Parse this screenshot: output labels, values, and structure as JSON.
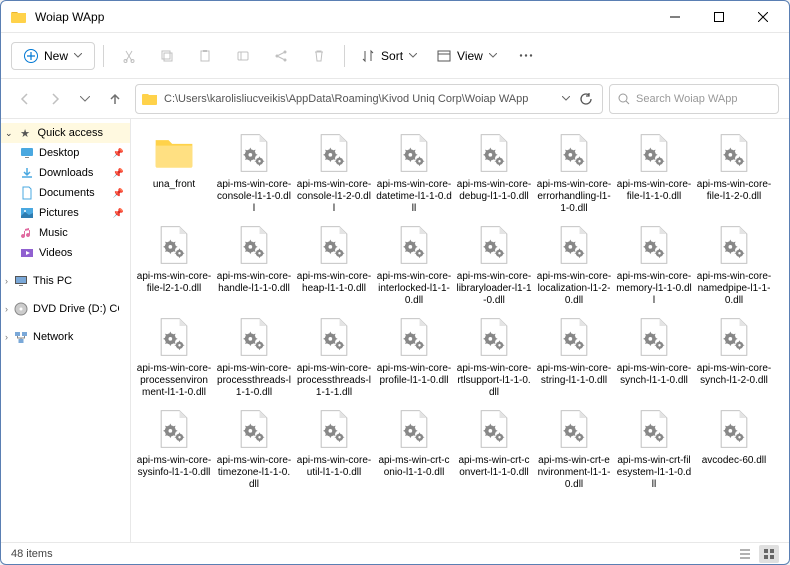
{
  "window": {
    "title": "Woiap WApp"
  },
  "toolbar": {
    "new_label": "New",
    "sort_label": "Sort",
    "view_label": "View"
  },
  "addressbar": {
    "path": "C:\\Users\\karolisliucveikis\\AppData\\Roaming\\Kivod Uniq Corp\\Woiap WApp",
    "search_placeholder": "Search Woiap WApp"
  },
  "sidebar": {
    "quick_access": "Quick access",
    "desktop": "Desktop",
    "downloads": "Downloads",
    "documents": "Documents",
    "pictures": "Pictures",
    "music": "Music",
    "videos": "Videos",
    "this_pc": "This PC",
    "dvd": "DVD Drive (D:) CCCC",
    "network": "Network"
  },
  "files": [
    {
      "name": "una_front",
      "type": "folder"
    },
    {
      "name": "api-ms-win-core-console-l1-1-0.dll",
      "type": "dll"
    },
    {
      "name": "api-ms-win-core-console-l1-2-0.dll",
      "type": "dll"
    },
    {
      "name": "api-ms-win-core-datetime-l1-1-0.dll",
      "type": "dll"
    },
    {
      "name": "api-ms-win-core-debug-l1-1-0.dll",
      "type": "dll"
    },
    {
      "name": "api-ms-win-core-errorhandling-l1-1-0.dll",
      "type": "dll"
    },
    {
      "name": "api-ms-win-core-file-l1-1-0.dll",
      "type": "dll"
    },
    {
      "name": "api-ms-win-core-file-l1-2-0.dll",
      "type": "dll"
    },
    {
      "name": "api-ms-win-core-file-l2-1-0.dll",
      "type": "dll"
    },
    {
      "name": "api-ms-win-core-handle-l1-1-0.dll",
      "type": "dll"
    },
    {
      "name": "api-ms-win-core-heap-l1-1-0.dll",
      "type": "dll"
    },
    {
      "name": "api-ms-win-core-interlocked-l1-1-0.dll",
      "type": "dll"
    },
    {
      "name": "api-ms-win-core-libraryloader-l1-1-0.dll",
      "type": "dll"
    },
    {
      "name": "api-ms-win-core-localization-l1-2-0.dll",
      "type": "dll"
    },
    {
      "name": "api-ms-win-core-memory-l1-1-0.dll",
      "type": "dll"
    },
    {
      "name": "api-ms-win-core-namedpipe-l1-1-0.dll",
      "type": "dll"
    },
    {
      "name": "api-ms-win-core-processenvironment-l1-1-0.dll",
      "type": "dll"
    },
    {
      "name": "api-ms-win-core-processthreads-l1-1-0.dll",
      "type": "dll"
    },
    {
      "name": "api-ms-win-core-processthreads-l1-1-1.dll",
      "type": "dll"
    },
    {
      "name": "api-ms-win-core-profile-l1-1-0.dll",
      "type": "dll"
    },
    {
      "name": "api-ms-win-core-rtlsupport-l1-1-0.dll",
      "type": "dll"
    },
    {
      "name": "api-ms-win-core-string-l1-1-0.dll",
      "type": "dll"
    },
    {
      "name": "api-ms-win-core-synch-l1-1-0.dll",
      "type": "dll"
    },
    {
      "name": "api-ms-win-core-synch-l1-2-0.dll",
      "type": "dll"
    },
    {
      "name": "api-ms-win-core-sysinfo-l1-1-0.dll",
      "type": "dll"
    },
    {
      "name": "api-ms-win-core-timezone-l1-1-0.dll",
      "type": "dll"
    },
    {
      "name": "api-ms-win-core-util-l1-1-0.dll",
      "type": "dll"
    },
    {
      "name": "api-ms-win-crt-conio-l1-1-0.dll",
      "type": "dll"
    },
    {
      "name": "api-ms-win-crt-convert-l1-1-0.dll",
      "type": "dll"
    },
    {
      "name": "api-ms-win-crt-environment-l1-1-0.dll",
      "type": "dll"
    },
    {
      "name": "api-ms-win-crt-filesystem-l1-1-0.dll",
      "type": "dll"
    },
    {
      "name": "avcodec-60.dll",
      "type": "dll"
    }
  ],
  "status": {
    "count": "48 items"
  },
  "colors": {
    "accent": "#0078d4",
    "folder": "#ffd24a",
    "folder_dark": "#e8b430"
  }
}
